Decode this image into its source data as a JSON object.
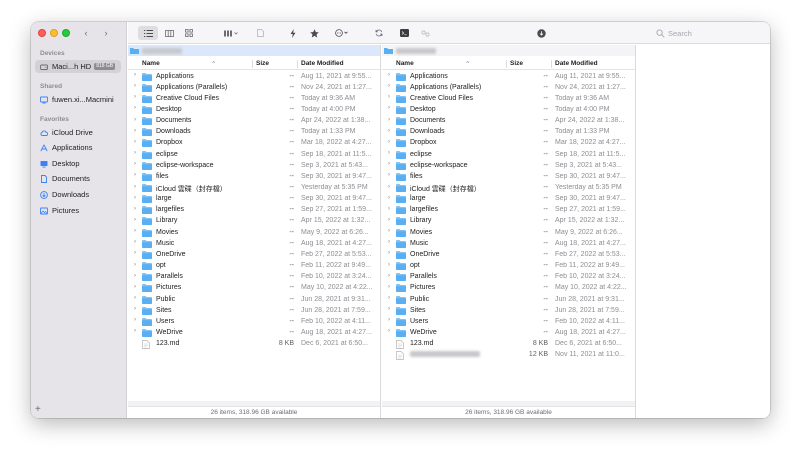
{
  "window": {
    "traffic_lights": [
      "close",
      "minimize",
      "zoom"
    ]
  },
  "sidebar": {
    "devices_label": "Devices",
    "device": {
      "name": "Maci...h HD",
      "badge": "818 GB",
      "icon": "disk-icon"
    },
    "shared_label": "Shared",
    "shared_item": {
      "name": "fuwen.xi...Macmini",
      "icon": "computer-icon"
    },
    "favorites_label": "Favorites",
    "favorites": [
      {
        "name": "iCloud Drive",
        "icon": "cloud-icon"
      },
      {
        "name": "Applications",
        "icon": "applications-icon"
      },
      {
        "name": "Desktop",
        "icon": "desktop-icon"
      },
      {
        "name": "Documents",
        "icon": "document-icon"
      },
      {
        "name": "Downloads",
        "icon": "download-icon"
      },
      {
        "name": "Pictures",
        "icon": "pictures-icon"
      }
    ],
    "add_label": "+"
  },
  "toolbar": {
    "back_icon": "chevron-left-icon",
    "forward_icon": "chevron-right-icon",
    "search_placeholder": "Search"
  },
  "columns": {
    "name": "Name",
    "size": "Size",
    "date": "Date Modified"
  },
  "left_pane": {
    "rows": [
      {
        "name": "Applications",
        "size": "--",
        "date": "Aug 11, 2021 at 9:55...",
        "type": "folder"
      },
      {
        "name": "Applications (Parallels)",
        "size": "--",
        "date": "Nov 24, 2021 at 1:27...",
        "type": "folder"
      },
      {
        "name": "Creative Cloud Files",
        "size": "--",
        "date": "Today at 9:36 AM",
        "type": "folder"
      },
      {
        "name": "Desktop",
        "size": "--",
        "date": "Today at 4:00 PM",
        "type": "folder"
      },
      {
        "name": "Documents",
        "size": "--",
        "date": "Apr 24, 2022 at 1:38...",
        "type": "folder"
      },
      {
        "name": "Downloads",
        "size": "--",
        "date": "Today at 1:33 PM",
        "type": "folder"
      },
      {
        "name": "Dropbox",
        "size": "--",
        "date": "Mar 18, 2022 at 4:27...",
        "type": "folder"
      },
      {
        "name": "eclipse",
        "size": "--",
        "date": "Sep 18, 2021 at 11:5...",
        "type": "folder"
      },
      {
        "name": "eclipse-workspace",
        "size": "--",
        "date": "Sep 3, 2021 at 5:43...",
        "type": "folder"
      },
      {
        "name": "files",
        "size": "--",
        "date": "Sep 30, 2021 at 9:47...",
        "type": "folder"
      },
      {
        "name": "iCloud 雲碟（封存檔）",
        "size": "--",
        "date": "Yesterday at 5:35 PM",
        "type": "folder"
      },
      {
        "name": "large",
        "size": "--",
        "date": "Sep 30, 2021 at 9:47...",
        "type": "folder"
      },
      {
        "name": "largefiles",
        "size": "--",
        "date": "Sep 27, 2021 at 1:59...",
        "type": "folder"
      },
      {
        "name": "Library",
        "size": "--",
        "date": "Apr 15, 2022 at 1:32...",
        "type": "folder"
      },
      {
        "name": "Movies",
        "size": "--",
        "date": "May 9, 2022 at 6:26...",
        "type": "folder"
      },
      {
        "name": "Music",
        "size": "--",
        "date": "Aug 18, 2021 at 4:27...",
        "type": "folder"
      },
      {
        "name": "OneDrive",
        "size": "--",
        "date": "Feb 27, 2022 at 5:53...",
        "type": "folder"
      },
      {
        "name": "opt",
        "size": "--",
        "date": "Feb 11, 2022 at 9:49...",
        "type": "folder"
      },
      {
        "name": "Parallels",
        "size": "--",
        "date": "Feb 10, 2022 at 3:24...",
        "type": "folder"
      },
      {
        "name": "Pictures",
        "size": "--",
        "date": "May 10, 2022 at 4:22...",
        "type": "folder"
      },
      {
        "name": "Public",
        "size": "--",
        "date": "Jun 28, 2021 at 9:31...",
        "type": "folder"
      },
      {
        "name": "Sites",
        "size": "--",
        "date": "Jun 28, 2021 at 7:59...",
        "type": "folder"
      },
      {
        "name": "Users",
        "size": "--",
        "date": "Feb 10, 2022 at 4:11...",
        "type": "folder"
      },
      {
        "name": "WeDrive",
        "size": "--",
        "date": "Aug 18, 2021 at 4:27...",
        "type": "folder"
      },
      {
        "name": "123.md",
        "size": "8 KB",
        "date": "Dec 6, 2021 at 6:50...",
        "type": "file"
      }
    ],
    "status": "26 items, 318.96 GB available"
  },
  "right_pane": {
    "rows": [
      {
        "name": "Applications",
        "size": "--",
        "date": "Aug 11, 2021 at 9:55...",
        "type": "folder"
      },
      {
        "name": "Applications (Parallels)",
        "size": "--",
        "date": "Nov 24, 2021 at 1:27...",
        "type": "folder"
      },
      {
        "name": "Creative Cloud Files",
        "size": "--",
        "date": "Today at 9:36 AM",
        "type": "folder"
      },
      {
        "name": "Desktop",
        "size": "--",
        "date": "Today at 4:00 PM",
        "type": "folder"
      },
      {
        "name": "Documents",
        "size": "--",
        "date": "Apr 24, 2022 at 1:38...",
        "type": "folder"
      },
      {
        "name": "Downloads",
        "size": "--",
        "date": "Today at 1:33 PM",
        "type": "folder"
      },
      {
        "name": "Dropbox",
        "size": "--",
        "date": "Mar 18, 2022 at 4:27...",
        "type": "folder"
      },
      {
        "name": "eclipse",
        "size": "--",
        "date": "Sep 18, 2021 at 11:5...",
        "type": "folder"
      },
      {
        "name": "eclipse-workspace",
        "size": "--",
        "date": "Sep 3, 2021 at 5:43...",
        "type": "folder"
      },
      {
        "name": "files",
        "size": "--",
        "date": "Sep 30, 2021 at 9:47...",
        "type": "folder"
      },
      {
        "name": "iCloud 雲碟（封存檔）",
        "size": "--",
        "date": "Yesterday at 5:35 PM",
        "type": "folder"
      },
      {
        "name": "large",
        "size": "--",
        "date": "Sep 30, 2021 at 9:47...",
        "type": "folder"
      },
      {
        "name": "largefiles",
        "size": "--",
        "date": "Sep 27, 2021 at 1:59...",
        "type": "folder"
      },
      {
        "name": "Library",
        "size": "--",
        "date": "Apr 15, 2022 at 1:32...",
        "type": "folder"
      },
      {
        "name": "Movies",
        "size": "--",
        "date": "May 9, 2022 at 6:26...",
        "type": "folder"
      },
      {
        "name": "Music",
        "size": "--",
        "date": "Aug 18, 2021 at 4:27...",
        "type": "folder"
      },
      {
        "name": "OneDrive",
        "size": "--",
        "date": "Feb 27, 2022 at 5:53...",
        "type": "folder"
      },
      {
        "name": "opt",
        "size": "--",
        "date": "Feb 11, 2022 at 9:49...",
        "type": "folder"
      },
      {
        "name": "Parallels",
        "size": "--",
        "date": "Feb 10, 2022 at 3:24...",
        "type": "folder"
      },
      {
        "name": "Pictures",
        "size": "--",
        "date": "May 10, 2022 at 4:22...",
        "type": "folder"
      },
      {
        "name": "Public",
        "size": "--",
        "date": "Jun 28, 2021 at 9:31...",
        "type": "folder"
      },
      {
        "name": "Sites",
        "size": "--",
        "date": "Jun 28, 2021 at 7:59...",
        "type": "folder"
      },
      {
        "name": "Users",
        "size": "--",
        "date": "Feb 10, 2022 at 4:11...",
        "type": "folder"
      },
      {
        "name": "WeDrive",
        "size": "--",
        "date": "Aug 18, 2021 at 4:27...",
        "type": "folder"
      },
      {
        "name": "123.md",
        "size": "8 KB",
        "date": "Dec 6, 2021 at 6:50...",
        "type": "file"
      },
      {
        "name": "",
        "size": "12 KB",
        "date": "Nov 11, 2021 at 11:0...",
        "type": "blurred"
      }
    ],
    "status": "26 items, 318.96 GB available"
  },
  "colors": {
    "folder": "#5aaef2",
    "folder_tab": "#7ec3f7",
    "sidebar_icon": "#3a82f7",
    "path_selected": "#dbe7fb"
  }
}
